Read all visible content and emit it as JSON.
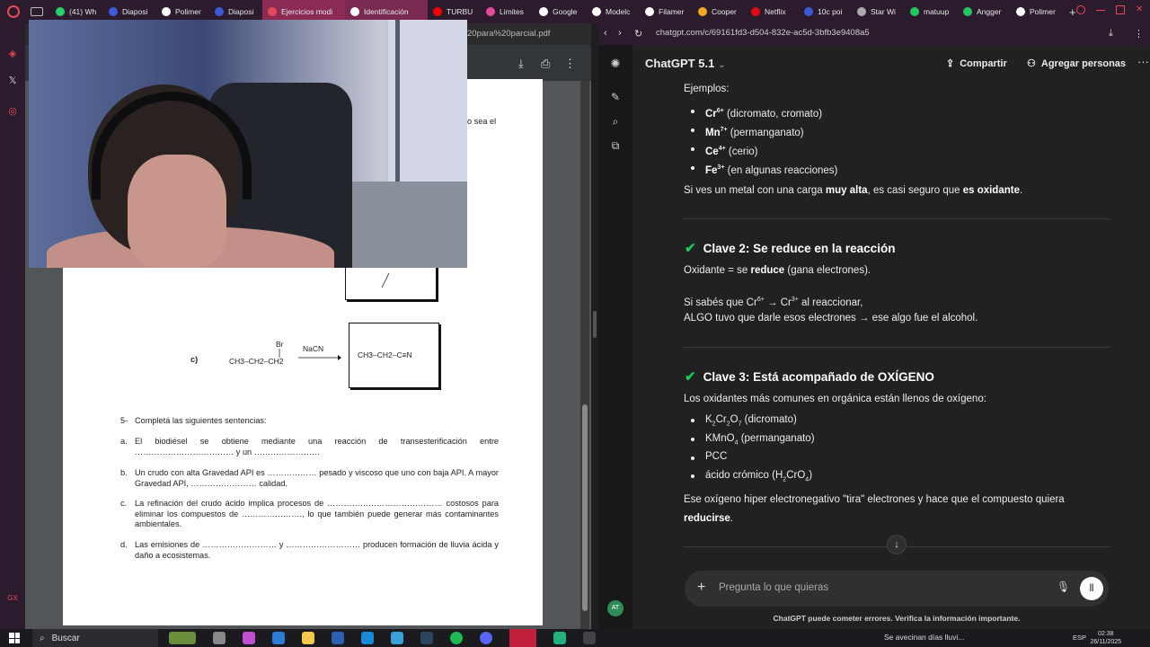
{
  "browser": {
    "tabs": [
      {
        "label": "(41) Wh",
        "color": "#25d366"
      },
      {
        "label": "Diaposi",
        "color": "#3b5bdb"
      },
      {
        "label": "Polimer",
        "color": "#ffffff"
      },
      {
        "label": "Diaposi",
        "color": "#3b5bdb"
      },
      {
        "label": "Ejercicios modi",
        "color": "#e64a5a"
      },
      {
        "label": "Identificación",
        "color": "#ffffff"
      },
      {
        "label": "TURBU",
        "color": "#ff0000"
      },
      {
        "label": "Limites",
        "color": "#e64a9a"
      },
      {
        "label": "Google",
        "color": "#ffffff"
      },
      {
        "label": "Modelc",
        "color": "#ffffff"
      },
      {
        "label": "Filamer",
        "color": "#ffffff"
      },
      {
        "label": "Cooper",
        "color": "#f5a623"
      },
      {
        "label": "Netflix",
        "color": "#e50914"
      },
      {
        "label": "10c poi",
        "color": "#3b5bdb"
      },
      {
        "label": "Star Wi",
        "color": "#aaaaaa"
      },
      {
        "label": "matuup",
        "color": "#22c55e"
      },
      {
        "label": "Angger",
        "color": "#22c55e"
      },
      {
        "label": "Polimer",
        "color": "#ffffff"
      }
    ],
    "new_tab": "+",
    "left_url_fragment": "20para%20parcial.pdf",
    "right_url": "chatgpt.com/c/69161fd3-d504-832e-ac5d-3bfb3e9408a5"
  },
  "pdf": {
    "reaction_c": {
      "label": "c)",
      "reactant": "CH3–CH2–CH2",
      "substituent": "Br",
      "reagent": "NaCN",
      "product": "CH3–CH2–C≡N"
    },
    "partial_right_text": "o sea el",
    "question_5": {
      "number": "5-",
      "title": "Completá las siguientes sentencias:",
      "items": [
        {
          "letter": "a.",
          "text": "El biodiésel se obtiene mediante una reacción de transesterificación entre ……………………………… y un ……………………"
        },
        {
          "letter": "b.",
          "text": "Un crudo con alta Gravedad API es ……………… pesado y viscoso que uno con baja API. A mayor Gravedad API, …………………… calidad."
        },
        {
          "letter": "c.",
          "text": "La refinación del crudo ácido implica procesos de …………………………………… costosos para eliminar los compuestos de …………………., lo que también puede generar más contaminantes ambientales."
        },
        {
          "letter": "d.",
          "text": "Las emisiones de ……………………… y ……………………… producen formación de lluvia ácida y daño a ecosistemas."
        }
      ]
    }
  },
  "chatgpt": {
    "model": "ChatGPT 5.1",
    "share_label": "Compartir",
    "add_people_label": "Agregar personas",
    "examples_heading": "Ejemplos:",
    "examples": [
      {
        "ion": "Cr",
        "charge": "6+",
        "note": "(dicromato, cromato)"
      },
      {
        "ion": "Mn",
        "charge": "7+",
        "note": "(permanganato)"
      },
      {
        "ion": "Ce",
        "charge": "4+",
        "note": "(cerio)"
      },
      {
        "ion": "Fe",
        "charge": "3+",
        "note": "(en algunas reacciones)"
      }
    ],
    "high_charge_text_1": "Si ves un metal con una carga ",
    "high_charge_bold_1": "muy alta",
    "high_charge_text_2": ", es casi seguro que ",
    "high_charge_bold_2": "es oxidante",
    "high_charge_text_3": ".",
    "clave2_title": "Clave 2: Se reduce en la reacción",
    "clave2_line_a": "Oxidante = se ",
    "clave2_line_b": "reduce",
    "clave2_line_c": " (gana electrones).",
    "clave2_p2_line1": "Si sabés que Cr6+ → Cr3+ al reaccionar,",
    "clave2_p2_line2": "ALGO tuvo que darle esos electrones → ese algo fue el alcohol.",
    "clave3_title": "Clave 3: Está acompañado de OXÍGENO",
    "clave3_intro": "Los oxidantes más comunes en orgánica están llenos de oxígeno:",
    "clave3_items": [
      "K2Cr2O7 (dicromato)",
      "KMnO4 (permanganato)",
      "PCC",
      "ácido crómico (H2CrO4)"
    ],
    "clave3_tail_1": "Ese oxígeno hiper electronegativo \"tira\" electrones y hace que el compuesto quiera",
    "clave3_tail_2": "reducirse",
    "clave3_tail_3": ".",
    "placeholder": "Pregunta lo que quieras",
    "disclaimer": "ChatGPT puede cometer errores. Verifica la información importante.",
    "avatar_initials": "AT"
  },
  "taskbar": {
    "search_label": "Buscar",
    "weather": "Se avecinan días lluvi...",
    "lang": "ESP",
    "time": "02:38",
    "date": "26/11/2025"
  },
  "colors": {
    "accent_green": "#22c55e",
    "active_tab": "#8b2a55",
    "chat_bg": "#212121"
  }
}
